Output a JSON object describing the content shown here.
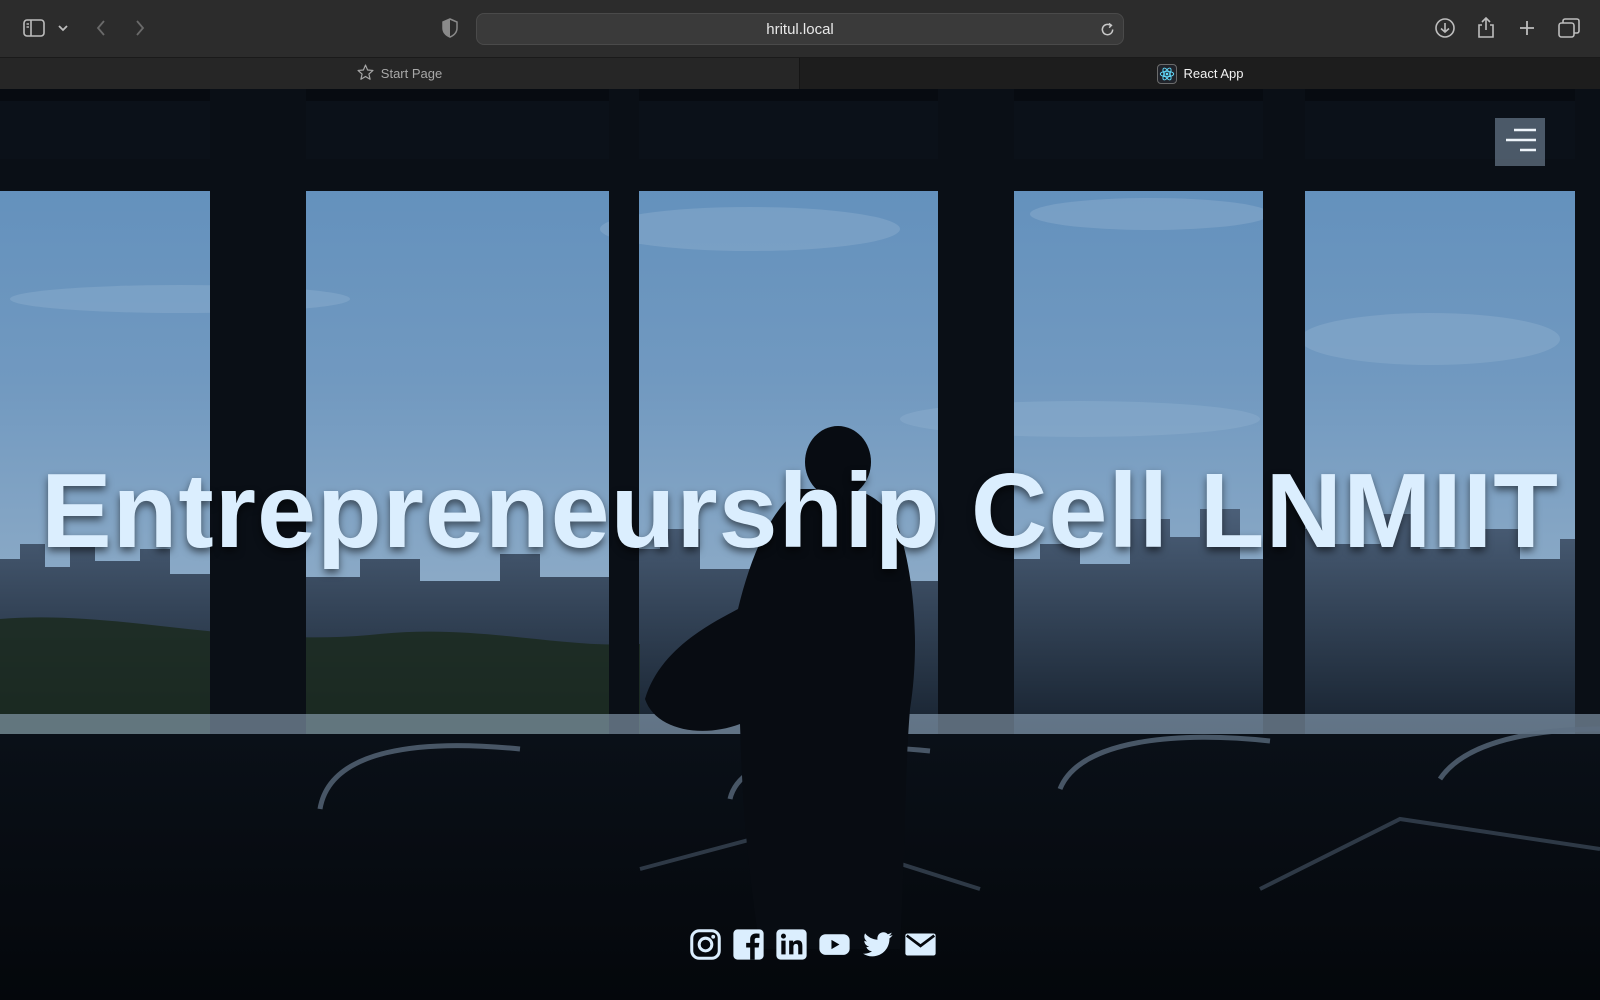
{
  "browser": {
    "url": "hritul.local",
    "tabs": [
      {
        "label": "Start Page",
        "icon": "star-icon",
        "active": false
      },
      {
        "label": "React App",
        "icon": "react-icon",
        "active": true
      }
    ],
    "toolbar_icons": [
      "sidebar-icon",
      "chevron-down-icon",
      "back-icon",
      "forward-icon",
      "shield-icon",
      "reload-icon",
      "download-icon",
      "share-icon",
      "new-tab-icon",
      "tab-overview-icon"
    ]
  },
  "hero": {
    "title": "Entrepreneurship Cell LNMIIT",
    "menu_icon": "hamburger-menu-icon"
  },
  "social_links": [
    "instagram-icon",
    "facebook-icon",
    "linkedin-icon",
    "youtube-icon",
    "twitter-icon",
    "email-icon"
  ],
  "colors": {
    "title_text": "#dbeefe",
    "sky": "#6f97c0",
    "frame": "#0a0f16",
    "toolbar_bg": "#2c2c2c"
  }
}
